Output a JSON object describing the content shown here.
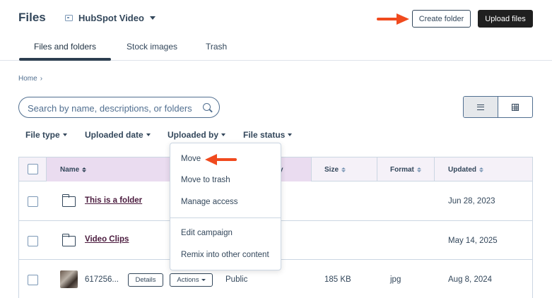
{
  "header": {
    "app_title": "Files",
    "account_name": "HubSpot Video",
    "create_folder_label": "Create folder",
    "upload_files_label": "Upload files"
  },
  "tabs": [
    {
      "label": "Files and folders",
      "active": true
    },
    {
      "label": "Stock images",
      "active": false
    },
    {
      "label": "Trash",
      "active": false
    }
  ],
  "breadcrumb": {
    "home": "Home",
    "separator": "›"
  },
  "search": {
    "placeholder": "Search by name, descriptions, or folders"
  },
  "view_toggle": {
    "selected": "list"
  },
  "filters": [
    {
      "label": "File type"
    },
    {
      "label": "Uploaded date"
    },
    {
      "label": "Uploaded by"
    },
    {
      "label": "File status"
    }
  ],
  "table": {
    "columns": {
      "name": "Name",
      "hidden_partial": "y",
      "size": "Size",
      "format": "Format",
      "updated": "Updated"
    },
    "rows": [
      {
        "type": "folder",
        "name": "This is a folder",
        "visibility": "",
        "size": "",
        "format": "",
        "updated": "Jun 28, 2023"
      },
      {
        "type": "folder",
        "name": "Video Clips",
        "visibility": "",
        "size": "",
        "format": "",
        "updated": "May 14, 2025"
      },
      {
        "type": "file",
        "name": "617256...",
        "details_label": "Details",
        "actions_label": "Actions",
        "visibility": "Public",
        "size": "185 KB",
        "format": "jpg",
        "updated": "Aug 8, 2024"
      }
    ]
  },
  "actions_menu": {
    "items": [
      "Move",
      "Move to trash",
      "Manage access"
    ],
    "items_2": [
      "Edit campaign",
      "Remix into other content"
    ]
  },
  "colors": {
    "accent_arrow": "#f04a1e",
    "primary_dark": "#1f1f1f",
    "header_highlight": "#eadcf0"
  }
}
